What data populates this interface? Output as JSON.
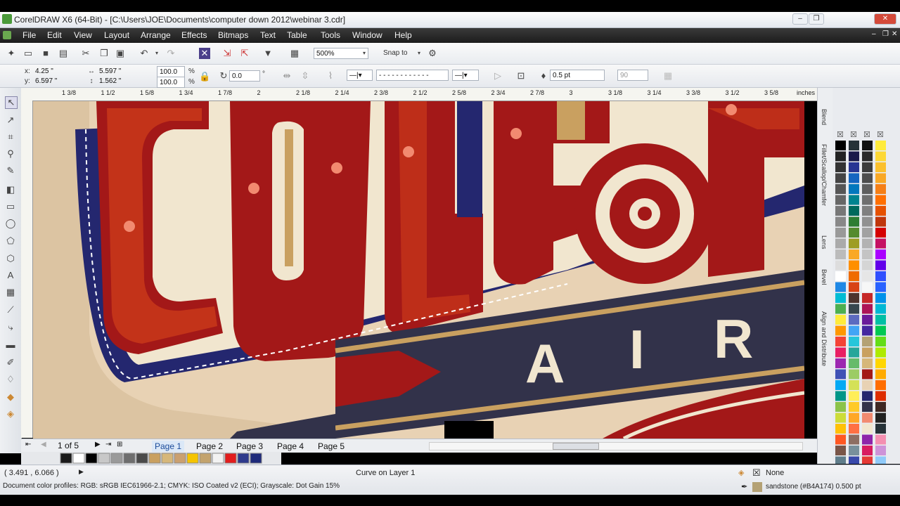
{
  "window": {
    "title": "CorelDRAW X6 (64-Bit) - [C:\\Users\\JOE\\Documents\\computer down 2012\\webinar 3.cdr]"
  },
  "menu": [
    "File",
    "Edit",
    "View",
    "Layout",
    "Arrange",
    "Effects",
    "Bitmaps",
    "Text",
    "Table",
    "Tools",
    "Window",
    "Help"
  ],
  "toolbar": {
    "zoom": "500%",
    "snap_to": "Snap to"
  },
  "property_bar": {
    "x": "4.25 \"",
    "y": "6.597 \"",
    "x_label": "x:",
    "y_label": "y:",
    "width": "5.597 \"",
    "height": "1.562 \"",
    "scale_x": "100.0",
    "scale_y": "100.0",
    "pct": "%",
    "rotation": "0.0",
    "deg": "°",
    "outline_width": "0.5 pt",
    "miter": "90"
  },
  "ruler": {
    "ticks": [
      "1 3/8",
      "1 1/2",
      "1 5/8",
      "1 3/4",
      "1 7/8",
      "2",
      "2 1/8",
      "2 1/4",
      "2 3/8",
      "2 1/2",
      "2 5/8",
      "2 3/4",
      "2 7/8",
      "3",
      "3 1/8",
      "3 1/4",
      "3 3/8",
      "3 1/2",
      "3 5/8"
    ],
    "units": "inches"
  },
  "artwork": {
    "banner_text": [
      "A",
      "I",
      "R"
    ]
  },
  "dockers": [
    "Blend",
    "Fillet/Scallop/Chamfer",
    "Lens",
    "Bevel",
    "Align and Distribute"
  ],
  "pages": {
    "indicator": "1 of 5",
    "tabs": [
      "Page 1",
      "Page 2",
      "Page 3",
      "Page 4",
      "Page 5"
    ]
  },
  "doc_palette": [
    "#1a1a1a",
    "#ffffff",
    "#000000",
    "#c8c8c8",
    "#9a9a9a",
    "#6e6e6e",
    "#4a4a4a",
    "#c9a060",
    "#d6b77a",
    "#caa070",
    "#f5c400",
    "#c3a36d",
    "#f2f2f2",
    "#e21d1d",
    "#2e3a8c",
    "#1e2a7a"
  ],
  "status": {
    "coords": "( 3.491 , 6.066 )",
    "object": "Curve on Layer 1",
    "profiles": "Document color profiles: RGB: sRGB IEC61966-2.1; CMYK: ISO Coated v2 (ECI); Grayscale: Dot Gain 15%",
    "fill": "None",
    "outline": "sandstone (#B4A174)  0.500 pt",
    "outline_color": "#b4a174"
  }
}
